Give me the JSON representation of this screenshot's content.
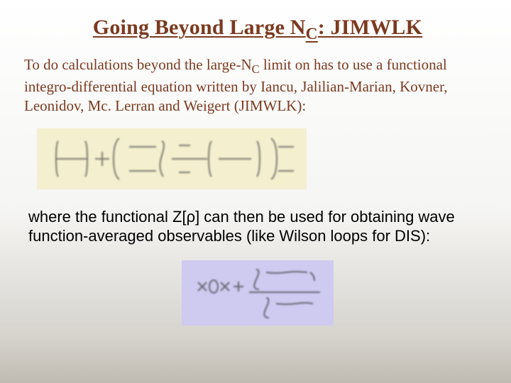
{
  "title": {
    "pre": "Going Beyond Large N",
    "sub": "C",
    "post": ": JIMWLK"
  },
  "para1": {
    "t1": "To do calculations beyond the large-N",
    "sub": "C",
    "t2": " limit on has to use a functional integro-differential equation written by Iancu, Jalilian-Marian, Kovner, Leonidov, Mc. Lerran and Weigert (JIMWLK):"
  },
  "para2": "where the functional Z[ρ] can then be used for obtaining wave function-averaged observables (like Wilson loops for DIS):",
  "eq1_alt": "functional integro-differential JIMWLK equation (illegible in source)",
  "eq2_alt": "functional average over ρ with Z[ρ] (illegible in source)"
}
